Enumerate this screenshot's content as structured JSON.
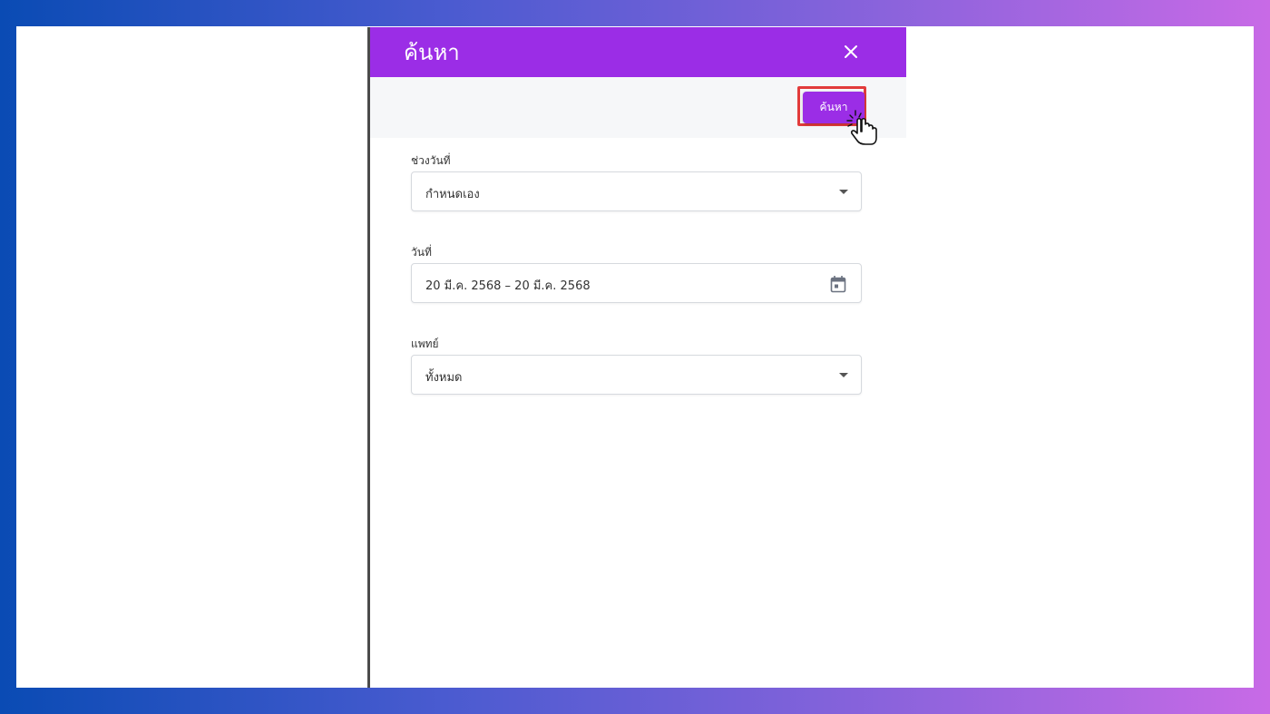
{
  "panel": {
    "title": "ค้นหา",
    "close_icon": "close-icon",
    "header_color": "#9b2de6"
  },
  "toolbar": {
    "search_label": "ค้นหา",
    "highlight_color": "#e23b3b"
  },
  "form": {
    "date_range": {
      "label": "ช่วงวันที่",
      "value": "กำหนดเอง"
    },
    "date": {
      "label": "วันที่",
      "value": "20 มี.ค. 2568 – 20 มี.ค. 2568",
      "icon": "calendar-icon"
    },
    "doctor": {
      "label": "แพทย์",
      "value": "ทั้งหมด"
    }
  }
}
